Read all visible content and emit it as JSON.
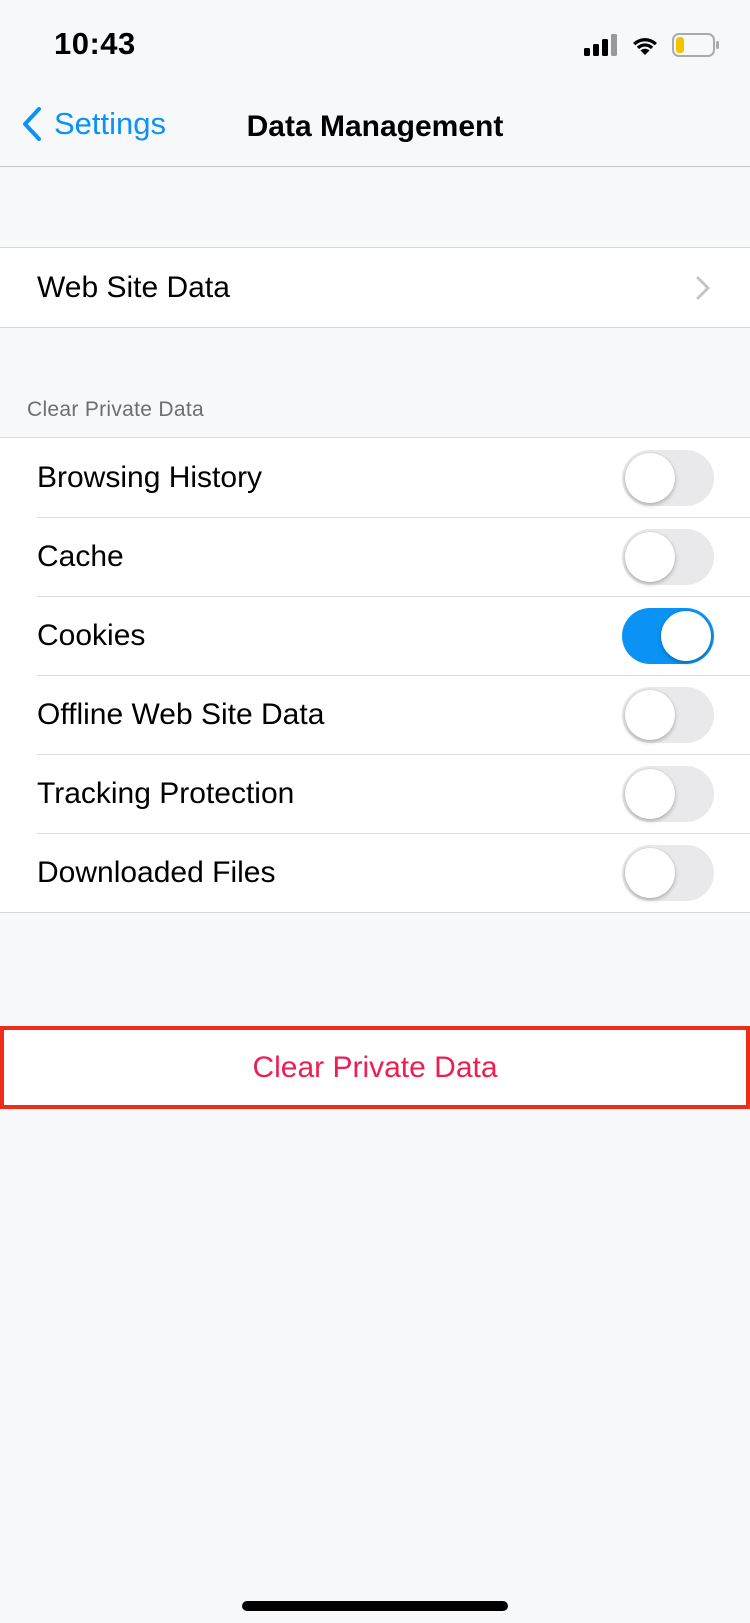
{
  "status_bar": {
    "time": "10:43"
  },
  "nav": {
    "back_label": "Settings",
    "title": "Data Management"
  },
  "website_data": {
    "label": "Web Site Data"
  },
  "clear_section": {
    "header": "Clear Private Data",
    "items": [
      {
        "label": "Browsing History",
        "enabled": false
      },
      {
        "label": "Cache",
        "enabled": false
      },
      {
        "label": "Cookies",
        "enabled": true
      },
      {
        "label": "Offline Web Site Data",
        "enabled": false
      },
      {
        "label": "Tracking Protection",
        "enabled": false
      },
      {
        "label": "Downloaded Files",
        "enabled": false
      }
    ]
  },
  "clear_button": {
    "label": "Clear Private Data"
  },
  "colors": {
    "accent": "#0a93f5",
    "destructive": "#ee1d52",
    "highlight_border": "#ee2c1a",
    "battery_low": "#f5c400"
  }
}
